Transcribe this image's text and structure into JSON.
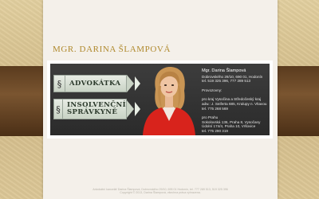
{
  "header": {
    "title": "MGR. DARINA ŠLAMPOVÁ"
  },
  "menu": [
    {
      "symbol": "§",
      "label_lines": [
        "ADVOKÁTKA"
      ]
    },
    {
      "symbol": "§",
      "label_lines": [
        "INSOLVENČNÍ",
        "SPRÁVKYNĚ"
      ]
    }
  ],
  "contact": {
    "name": "Mgr. Darina Šlampová",
    "address": "Dobrovského 29/10, 690 01, Hodonín",
    "phones": "tel. 519 325 396, 777 289 513",
    "offices_heading": "Provozovny:",
    "office1": [
      "pro kraj Vysočina a Středočeský kraj",
      "adw.: J. Seiferta 685, Kralupy n. Vltavou",
      "tel. 775 268 569"
    ],
    "office2": [
      "pro Prahu",
      "Sokolovská 136, Praha 8, Vysočany",
      "Údolní 174/4, Praha 10, Vršovice",
      "tel. 775 290 319"
    ]
  },
  "footer": {
    "lines": [
      "Advokátní kancelář Darina Šlampová, Dobrovského 29/10, 695 01 Hodonín, tel. 777 289 513, 519 325 396",
      "Copyright © 2013, Darina Šlampová, všechna práva vyhrazena."
    ]
  },
  "colors": {
    "page_background": "#d9c496",
    "content_background": "#f4f0ea",
    "header_gold": "#b08a2e",
    "banner_dark": "#333333",
    "button_fill": "#d6ded2",
    "band_brown": "#6b4a28"
  }
}
